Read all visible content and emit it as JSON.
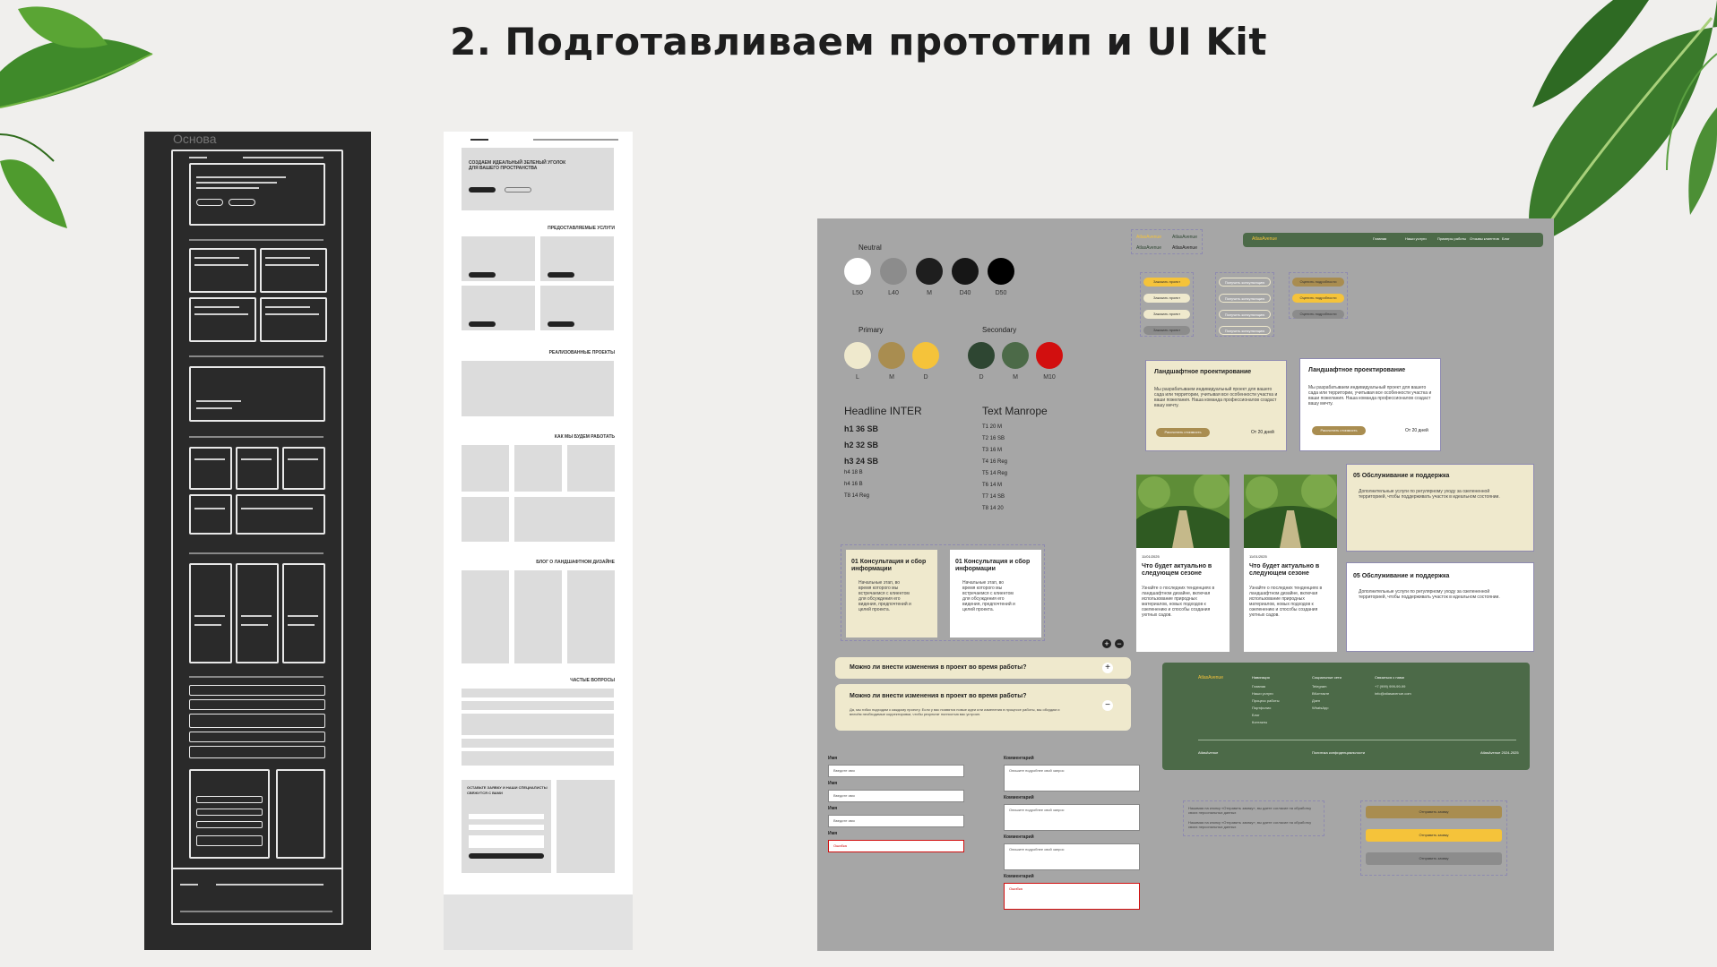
{
  "title": "2. Подготавливаем прототип и UI Kit",
  "wireframe": {
    "label": "Основа"
  },
  "prototype": {
    "hero_title": "СОЗДАЕМ ИДЕАЛЬНЫЙ ЗЕЛЕНЫЙ УГОЛОК ДЛЯ ВАШЕГО ПРОСТРАНСТВА",
    "section_services": "ПРЕДОСТАВЛЯЕМЫЕ УСЛУГИ",
    "section_projects": "РЕАЛИЗОВАННЫЕ ПРОЕКТЫ",
    "section_process": "КАК МЫ БУДЕМ РАБОТАТЬ",
    "section_blog": "БЛОГ О ЛАНДШАФТНОМ ДИЗАЙНЕ",
    "section_faq": "ЧАСТЫЕ ВОПРОСЫ",
    "form_title": "ОСТАВЬТЕ ЗАЯВКУ И НАШИ СПЕЦИАЛИСТЫ СВЯЖУТСЯ С ВАМИ"
  },
  "kit": {
    "neutral_label": "Neutral",
    "neutral": [
      {
        "name": "L50",
        "color": "#ffffff"
      },
      {
        "name": "L40",
        "color": "#8c8c8c"
      },
      {
        "name": "M",
        "color": "#1e1e1e"
      },
      {
        "name": "D40",
        "color": "#161616"
      },
      {
        "name": "D50",
        "color": "#000000"
      }
    ],
    "primary_label": "Primary",
    "primary": [
      {
        "name": "L",
        "color": "#efe9cd"
      },
      {
        "name": "M",
        "color": "#a98d50"
      },
      {
        "name": "D",
        "color": "#f5c33a"
      }
    ],
    "secondary_label": "Secondary",
    "secondary": [
      {
        "name": "D",
        "color": "#2e4632"
      },
      {
        "name": "M",
        "color": "#4c6a48"
      },
      {
        "name": "M10",
        "color": "#d20f0f"
      }
    ],
    "headline_label": "Headline INTER",
    "headline_styles": [
      "h1 36 SB",
      "h2 32 SB",
      "h3 24 SB",
      "h4 18 B",
      "h4 16 B",
      "T8 14 Reg"
    ],
    "text_label": "Text Manrope",
    "text_styles": [
      "T1 20 M",
      "T2 16 SB",
      "T3 16 M",
      "T4 16 Reg",
      "T5 14 Reg",
      "T6 14 M",
      "T7 14 SB",
      "T8 14 20"
    ],
    "service_title": "Ландшафтное проектирование",
    "service_text": "Мы разрабатываем индивидуальный проект для вашего сада или территории, учитывая все особенности участка и ваши пожелания. Наша команда профессионалов создаст вашу мечту.",
    "service_button": "Рассчитать стоимость",
    "service_price": "От 20 дней",
    "step_title": "01 Консультация и сбор информации",
    "step_text": "Начальные этап, во время которого мы встречаемся с клиентом для обсуждения его видения, предпочтений и целей проекта.",
    "blog_date": "11/01/2025",
    "blog_title": "Что будет актуально в следующем сезоне",
    "blog_text": "Узнайте о последних тенденциях в ландшафтном дизайне, включая использование природных материалов, новых подходов к озеленению и способы создания уютных садов.",
    "maint_title": "05 Обслуживание и поддержка",
    "maint_text": "Дополнительные услуги по регулярному уходу за озелененной территорией, чтобы поддерживать участок в идеальном состоянии.",
    "faq_q": "Можно ли внести изменения в проект во время работы?",
    "faq_a": "Да, мы гибко подходим к каждому проекту. Если у вас появятся новые идеи или изменения в процессе работы, мы обсудим и внесём необходимые корректировки, чтобы результат полностью вас устроил.",
    "field_label_name": "Имя",
    "field_placeholder_name": "Введите имя",
    "field_label_comment": "Комментарий",
    "field_placeholder_comment": "Опишите подробнее свой запрос",
    "field_error": "Ошибка",
    "nav_logo": "AtlasAvenue",
    "nav_links": [
      "Главная",
      "Наши услуги",
      "Примеры работы",
      "Отзывы клиентов",
      "Блог"
    ],
    "buttons_yellow": [
      "Заказать проект",
      "Заказать проект",
      "Заказать проект",
      "Заказать проект"
    ],
    "buttons_outline": [
      "Получить консультацию",
      "Получить консультацию",
      "Получить консультацию",
      "Получить консультацию"
    ],
    "buttons_brown": [
      "Оценить подробности",
      "Оценить подробности",
      "Оценить подробности"
    ],
    "consent_text": "Нажимая на кнопку «Отправить заявку», вы даете согласие на обработку своих персональных данных",
    "submit_labels": [
      "Отправить заявку",
      "Отправить заявку",
      "Отправить заявку"
    ],
    "footer": {
      "logo": "AtlasAvenue",
      "col1_title": "Навигация",
      "col1": [
        "Главная",
        "Наши услуги",
        "Процесс работы",
        "Портфолио",
        "Блог",
        "Контакты"
      ],
      "col2_title": "Социальные сети",
      "col2": [
        "Telegram",
        "ВКонтакте",
        "Дзен",
        "WhatsApp"
      ],
      "col3_title": "Связаться с нами",
      "col3": [
        "+7 (999) 999-99-99",
        "info@atlasavenue.com"
      ],
      "bottom_left": "AtlasAvenue",
      "bottom_mid": "Политика конфиденциальности",
      "bottom_right": "AtlasAvenue 2024-2025"
    }
  }
}
